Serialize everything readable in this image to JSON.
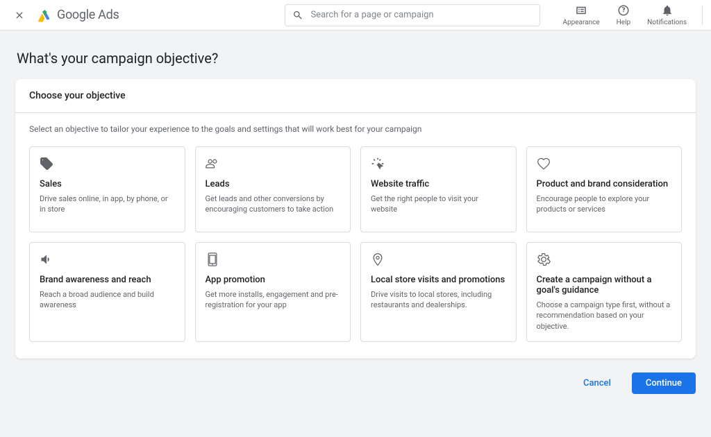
{
  "header": {
    "logo_text": "Google Ads",
    "search_placeholder": "Search for a page or campaign",
    "actions": {
      "appearance": "Appearance",
      "help": "Help",
      "notifications": "Notifications"
    }
  },
  "page": {
    "title": "What's your campaign objective?",
    "card_title": "Choose your objective",
    "subtitle": "Select an objective to tailor your experience to the goals and settings that will work best for your campaign"
  },
  "objectives": [
    {
      "title": "Sales",
      "desc": "Drive sales online, in app, by phone, or in store"
    },
    {
      "title": "Leads",
      "desc": "Get leads and other conversions by encouraging customers to take action"
    },
    {
      "title": "Website traffic",
      "desc": "Get the right people to visit your website"
    },
    {
      "title": "Product and brand consideration",
      "desc": "Encourage people to explore your products or services"
    },
    {
      "title": "Brand awareness and reach",
      "desc": "Reach a broad audience and build awareness"
    },
    {
      "title": "App promotion",
      "desc": "Get more installs, engagement and pre-registration for your app"
    },
    {
      "title": "Local store visits and promotions",
      "desc": "Drive visits to local stores, including restaurants and dealerships."
    },
    {
      "title": "Create a campaign without a goal's guidance",
      "desc": "Choose a campaign type first, without a recommendation based on your objective."
    }
  ],
  "buttons": {
    "cancel": "Cancel",
    "continue": "Continue"
  }
}
